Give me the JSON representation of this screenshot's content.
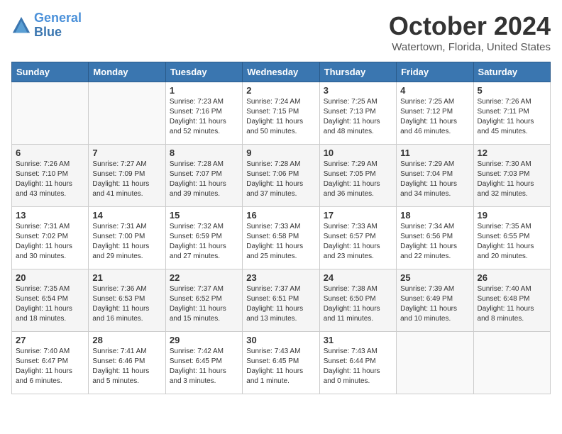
{
  "header": {
    "logo_line1": "General",
    "logo_line2": "Blue",
    "month": "October 2024",
    "location": "Watertown, Florida, United States"
  },
  "weekdays": [
    "Sunday",
    "Monday",
    "Tuesday",
    "Wednesday",
    "Thursday",
    "Friday",
    "Saturday"
  ],
  "weeks": [
    [
      {
        "day": "",
        "sunrise": "",
        "sunset": "",
        "daylight": ""
      },
      {
        "day": "",
        "sunrise": "",
        "sunset": "",
        "daylight": ""
      },
      {
        "day": "1",
        "sunrise": "Sunrise: 7:23 AM",
        "sunset": "Sunset: 7:16 PM",
        "daylight": "Daylight: 11 hours and 52 minutes."
      },
      {
        "day": "2",
        "sunrise": "Sunrise: 7:24 AM",
        "sunset": "Sunset: 7:15 PM",
        "daylight": "Daylight: 11 hours and 50 minutes."
      },
      {
        "day": "3",
        "sunrise": "Sunrise: 7:25 AM",
        "sunset": "Sunset: 7:13 PM",
        "daylight": "Daylight: 11 hours and 48 minutes."
      },
      {
        "day": "4",
        "sunrise": "Sunrise: 7:25 AM",
        "sunset": "Sunset: 7:12 PM",
        "daylight": "Daylight: 11 hours and 46 minutes."
      },
      {
        "day": "5",
        "sunrise": "Sunrise: 7:26 AM",
        "sunset": "Sunset: 7:11 PM",
        "daylight": "Daylight: 11 hours and 45 minutes."
      }
    ],
    [
      {
        "day": "6",
        "sunrise": "Sunrise: 7:26 AM",
        "sunset": "Sunset: 7:10 PM",
        "daylight": "Daylight: 11 hours and 43 minutes."
      },
      {
        "day": "7",
        "sunrise": "Sunrise: 7:27 AM",
        "sunset": "Sunset: 7:09 PM",
        "daylight": "Daylight: 11 hours and 41 minutes."
      },
      {
        "day": "8",
        "sunrise": "Sunrise: 7:28 AM",
        "sunset": "Sunset: 7:07 PM",
        "daylight": "Daylight: 11 hours and 39 minutes."
      },
      {
        "day": "9",
        "sunrise": "Sunrise: 7:28 AM",
        "sunset": "Sunset: 7:06 PM",
        "daylight": "Daylight: 11 hours and 37 minutes."
      },
      {
        "day": "10",
        "sunrise": "Sunrise: 7:29 AM",
        "sunset": "Sunset: 7:05 PM",
        "daylight": "Daylight: 11 hours and 36 minutes."
      },
      {
        "day": "11",
        "sunrise": "Sunrise: 7:29 AM",
        "sunset": "Sunset: 7:04 PM",
        "daylight": "Daylight: 11 hours and 34 minutes."
      },
      {
        "day": "12",
        "sunrise": "Sunrise: 7:30 AM",
        "sunset": "Sunset: 7:03 PM",
        "daylight": "Daylight: 11 hours and 32 minutes."
      }
    ],
    [
      {
        "day": "13",
        "sunrise": "Sunrise: 7:31 AM",
        "sunset": "Sunset: 7:02 PM",
        "daylight": "Daylight: 11 hours and 30 minutes."
      },
      {
        "day": "14",
        "sunrise": "Sunrise: 7:31 AM",
        "sunset": "Sunset: 7:00 PM",
        "daylight": "Daylight: 11 hours and 29 minutes."
      },
      {
        "day": "15",
        "sunrise": "Sunrise: 7:32 AM",
        "sunset": "Sunset: 6:59 PM",
        "daylight": "Daylight: 11 hours and 27 minutes."
      },
      {
        "day": "16",
        "sunrise": "Sunrise: 7:33 AM",
        "sunset": "Sunset: 6:58 PM",
        "daylight": "Daylight: 11 hours and 25 minutes."
      },
      {
        "day": "17",
        "sunrise": "Sunrise: 7:33 AM",
        "sunset": "Sunset: 6:57 PM",
        "daylight": "Daylight: 11 hours and 23 minutes."
      },
      {
        "day": "18",
        "sunrise": "Sunrise: 7:34 AM",
        "sunset": "Sunset: 6:56 PM",
        "daylight": "Daylight: 11 hours and 22 minutes."
      },
      {
        "day": "19",
        "sunrise": "Sunrise: 7:35 AM",
        "sunset": "Sunset: 6:55 PM",
        "daylight": "Daylight: 11 hours and 20 minutes."
      }
    ],
    [
      {
        "day": "20",
        "sunrise": "Sunrise: 7:35 AM",
        "sunset": "Sunset: 6:54 PM",
        "daylight": "Daylight: 11 hours and 18 minutes."
      },
      {
        "day": "21",
        "sunrise": "Sunrise: 7:36 AM",
        "sunset": "Sunset: 6:53 PM",
        "daylight": "Daylight: 11 hours and 16 minutes."
      },
      {
        "day": "22",
        "sunrise": "Sunrise: 7:37 AM",
        "sunset": "Sunset: 6:52 PM",
        "daylight": "Daylight: 11 hours and 15 minutes."
      },
      {
        "day": "23",
        "sunrise": "Sunrise: 7:37 AM",
        "sunset": "Sunset: 6:51 PM",
        "daylight": "Daylight: 11 hours and 13 minutes."
      },
      {
        "day": "24",
        "sunrise": "Sunrise: 7:38 AM",
        "sunset": "Sunset: 6:50 PM",
        "daylight": "Daylight: 11 hours and 11 minutes."
      },
      {
        "day": "25",
        "sunrise": "Sunrise: 7:39 AM",
        "sunset": "Sunset: 6:49 PM",
        "daylight": "Daylight: 11 hours and 10 minutes."
      },
      {
        "day": "26",
        "sunrise": "Sunrise: 7:40 AM",
        "sunset": "Sunset: 6:48 PM",
        "daylight": "Daylight: 11 hours and 8 minutes."
      }
    ],
    [
      {
        "day": "27",
        "sunrise": "Sunrise: 7:40 AM",
        "sunset": "Sunset: 6:47 PM",
        "daylight": "Daylight: 11 hours and 6 minutes."
      },
      {
        "day": "28",
        "sunrise": "Sunrise: 7:41 AM",
        "sunset": "Sunset: 6:46 PM",
        "daylight": "Daylight: 11 hours and 5 minutes."
      },
      {
        "day": "29",
        "sunrise": "Sunrise: 7:42 AM",
        "sunset": "Sunset: 6:45 PM",
        "daylight": "Daylight: 11 hours and 3 minutes."
      },
      {
        "day": "30",
        "sunrise": "Sunrise: 7:43 AM",
        "sunset": "Sunset: 6:45 PM",
        "daylight": "Daylight: 11 hours and 1 minute."
      },
      {
        "day": "31",
        "sunrise": "Sunrise: 7:43 AM",
        "sunset": "Sunset: 6:44 PM",
        "daylight": "Daylight: 11 hours and 0 minutes."
      },
      {
        "day": "",
        "sunrise": "",
        "sunset": "",
        "daylight": ""
      },
      {
        "day": "",
        "sunrise": "",
        "sunset": "",
        "daylight": ""
      }
    ]
  ]
}
